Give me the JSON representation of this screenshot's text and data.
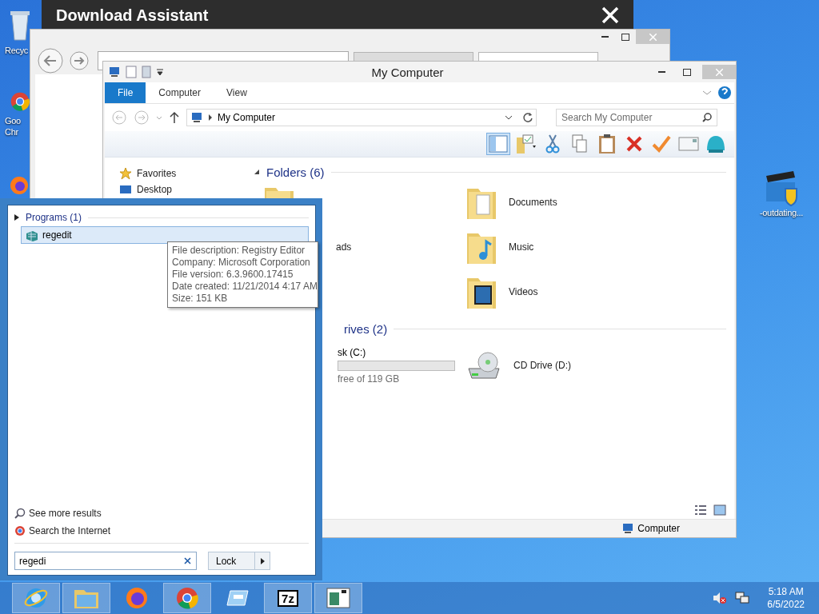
{
  "desktop_icons": [
    {
      "kind": "recycle",
      "lines": [
        "Recyc"
      ]
    },
    {
      "kind": "chrome",
      "lines": [
        "Goo",
        "Chr"
      ]
    },
    {
      "kind": "firefox"
    }
  ],
  "desktop_shortcut": {
    "label": "-outdating..."
  },
  "download_assistant": {
    "title": "Download Assistant"
  },
  "explorer": {
    "title": "My Computer",
    "ribbon_tabs": [
      {
        "label": "File",
        "selected": true
      },
      {
        "label": "Computer",
        "selected": false
      },
      {
        "label": "View",
        "selected": false
      }
    ],
    "address": {
      "path": "My Computer"
    },
    "search": {
      "placeholder": "Search My Computer"
    },
    "toolbar": [
      {
        "kind": "pane",
        "selected": true
      },
      {
        "kind": "folder-check",
        "selected": false
      },
      {
        "kind": "cut",
        "selected": false
      },
      {
        "kind": "copy",
        "selected": false
      },
      {
        "kind": "paste",
        "selected": false
      },
      {
        "kind": "delete",
        "selected": false
      },
      {
        "kind": "check",
        "selected": false
      },
      {
        "kind": "mail",
        "selected": false
      },
      {
        "kind": "shell",
        "selected": false
      }
    ],
    "nav": [
      {
        "kind": "star",
        "label": "Favorites"
      },
      {
        "kind": "monitor",
        "label": "Desktop"
      }
    ],
    "folders": {
      "header": "Folders (6)",
      "rows": [
        {
          "left": "",
          "right": {
            "kind": "documents",
            "label": "Documents"
          }
        },
        {
          "left": "ads",
          "right": {
            "kind": "music",
            "label": "Music"
          }
        },
        {
          "left": "",
          "right": {
            "kind": "videos",
            "label": "Videos"
          }
        }
      ]
    },
    "drives": {
      "header": "rives (2)",
      "left": {
        "label": "sk (C:)",
        "detail": "free of 119 GB"
      },
      "right": {
        "label": "CD Drive (D:)"
      }
    },
    "status": "Computer"
  },
  "start_menu": {
    "group": "Programs (1)",
    "results": [
      {
        "label": "regedit",
        "selected": true
      }
    ],
    "tooltip": [
      "File description: Registry Editor",
      "Company: Microsoft Corporation",
      "File version: 6.3.9600.17415",
      "Date created: 11/21/2014 4:17 AM",
      "Size: 151 KB"
    ],
    "links": [
      {
        "kind": "search",
        "label": "See more results"
      },
      {
        "kind": "chrome",
        "label": "Search the Internet"
      }
    ],
    "search_value": "regedi",
    "power_button": "Lock"
  },
  "taskbar": {
    "apps": [
      {
        "kind": "ie",
        "running": true
      },
      {
        "kind": "explorer",
        "running": true
      },
      {
        "kind": "firefox",
        "running": false
      },
      {
        "kind": "chrome",
        "running": true
      },
      {
        "kind": "drive",
        "running": false
      },
      {
        "kind": "sevenzip",
        "label": "7z",
        "running": true
      },
      {
        "kind": "window",
        "running": true
      }
    ],
    "clock": {
      "time": "5:18 AM",
      "date": "6/5/2022"
    }
  }
}
